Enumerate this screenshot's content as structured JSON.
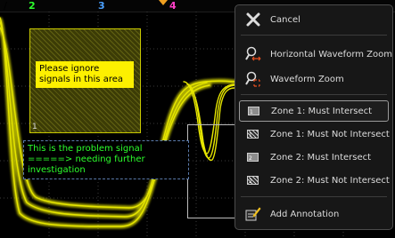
{
  "channels": [
    {
      "label": "∕",
      "color": "#d0d0d0"
    },
    {
      "label": "2",
      "color": "#2cff2c"
    },
    {
      "label": "3",
      "color": "#4aa0ff"
    },
    {
      "label": "4",
      "color": "#ff40c8"
    }
  ],
  "zones": {
    "zone1_number": "1",
    "zone2_number": "2"
  },
  "annotations": {
    "note1": "Please ignore signals in this area",
    "note2": "This is the problem signal =====> needing further investigation"
  },
  "menu": {
    "items": [
      {
        "label": "Cancel",
        "icon": "close-icon"
      },
      {
        "label": "Horizontal Waveform Zoom",
        "icon": "horizontal-zoom-icon"
      },
      {
        "label": "Waveform Zoom",
        "icon": "waveform-zoom-icon"
      },
      {
        "label": "Zone 1: Must Intersect",
        "icon": "zone-1-must-intersect-icon",
        "selected": true
      },
      {
        "label": "Zone 1: Must Not Intersect",
        "icon": "zone-1-must-not-intersect-icon"
      },
      {
        "label": "Zone 2: Must Intersect",
        "icon": "zone-2-must-intersect-icon"
      },
      {
        "label": "Zone 2: Must Not Intersect",
        "icon": "zone-2-must-not-intersect-icon"
      },
      {
        "label": "Add Annotation",
        "icon": "add-annotation-icon"
      }
    ],
    "zone_icon_numbers": [
      "1",
      "1",
      "2",
      "2"
    ]
  },
  "colors": {
    "trace": "#e6e600",
    "trigger_marker": "#f0a020",
    "menu_background": "#171717",
    "annotation_background": "#fdf000",
    "annotation_text": "#2cff2c"
  }
}
